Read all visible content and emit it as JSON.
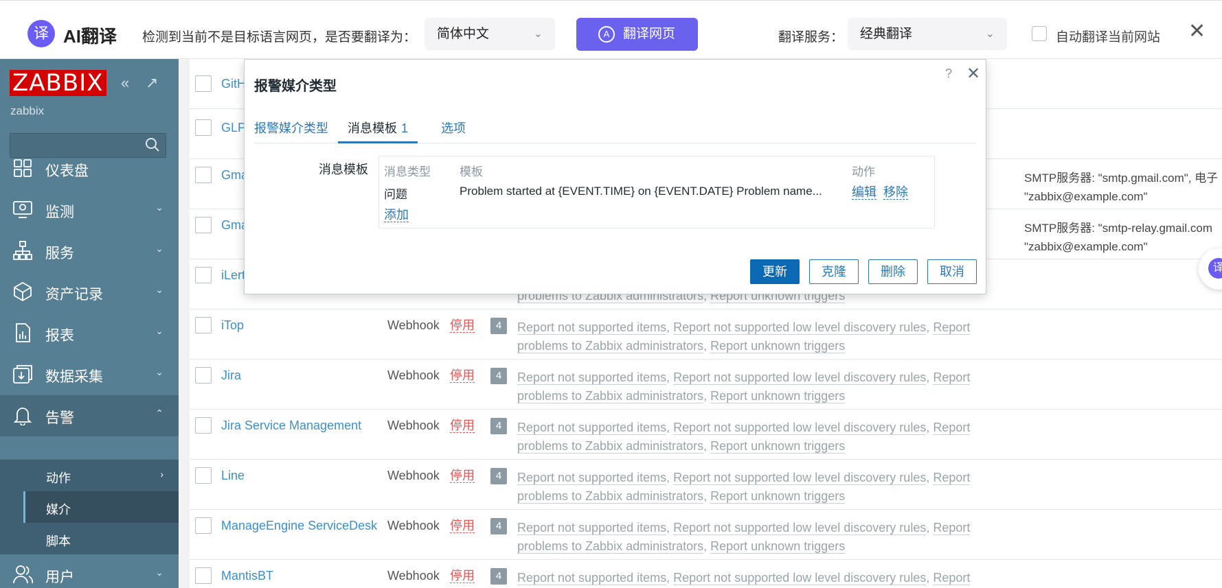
{
  "translate_bar": {
    "logo_char": "译",
    "brand": "AI翻译",
    "prompt": "检测到当前不是目标语言网页，是否要翻译为：",
    "target_language": "简体中文",
    "translate_button": "翻译网页",
    "service_label": "翻译服务：",
    "service_value": "经典翻译",
    "auto_label": "自动翻译当前网站",
    "accent": "#6b61ef"
  },
  "sidebar": {
    "logo": "ZABBIX",
    "server_name": "zabbix",
    "search_placeholder": "",
    "items": [
      {
        "label": "仪表盘"
      },
      {
        "label": "监测"
      },
      {
        "label": "服务"
      },
      {
        "label": "资产记录"
      },
      {
        "label": "报表"
      },
      {
        "label": "数据采集"
      },
      {
        "label": "告警"
      },
      {
        "label": "用户"
      }
    ],
    "sub_items": [
      {
        "label": "动作"
      },
      {
        "label": "媒介"
      },
      {
        "label": "脚本"
      }
    ]
  },
  "table": {
    "rows": [
      {
        "name": "GitHub",
        "type": "",
        "status": "",
        "count": "",
        "actions": [],
        "params": ""
      },
      {
        "name": "GLPi",
        "type": "",
        "status": "",
        "count": "",
        "actions": [],
        "params": ""
      },
      {
        "name": "Gmail",
        "type": "",
        "status": "",
        "count": "",
        "actions": [],
        "params": "SMTP服务器: \"smtp.gmail.com\", 电子",
        "params2": "\"zabbix@example.com\""
      },
      {
        "name": "Gmail relay",
        "type": "",
        "status": "",
        "count": "",
        "actions": [],
        "params": "SMTP服务器: \"smtp-relay.gmail.com",
        "params2": "\"zabbix@example.com\""
      },
      {
        "name": "iLert",
        "type": "",
        "status": "",
        "count": "",
        "actions": [
          "problems to Zabbix administrators",
          "Report unknown triggers"
        ],
        "params": ""
      },
      {
        "name": "iTop",
        "type": "Webhook",
        "status": "停用",
        "count": "4",
        "actions": [
          "Report not supported items",
          "Report not supported low level discovery rules",
          "Report problems to Zabbix administrators",
          "Report unknown triggers"
        ],
        "params": ""
      },
      {
        "name": "Jira",
        "type": "Webhook",
        "status": "停用",
        "count": "4",
        "actions": [
          "Report not supported items",
          "Report not supported low level discovery rules",
          "Report problems to Zabbix administrators",
          "Report unknown triggers"
        ],
        "params": ""
      },
      {
        "name": "Jira Service Management",
        "type": "Webhook",
        "status": "停用",
        "count": "4",
        "actions": [
          "Report not supported items",
          "Report not supported low level discovery rules",
          "Report problems to Zabbix administrators",
          "Report unknown triggers"
        ],
        "params": ""
      },
      {
        "name": "Line",
        "type": "Webhook",
        "status": "停用",
        "count": "4",
        "actions": [
          "Report not supported items",
          "Report not supported low level discovery rules",
          "Report problems to Zabbix administrators",
          "Report unknown triggers"
        ],
        "params": ""
      },
      {
        "name": "ManageEngine ServiceDesk",
        "type": "Webhook",
        "status": "停用",
        "count": "4",
        "actions": [
          "Report not supported items",
          "Report not supported low level discovery rules",
          "Report problems to Zabbix administrators",
          "Report unknown triggers"
        ],
        "params": ""
      },
      {
        "name": "MantisBT",
        "type": "Webhook",
        "status": "停用",
        "count": "4",
        "actions": [
          "Report not supported items",
          "Report not supported low level discovery rules",
          "Report"
        ],
        "params": ""
      }
    ]
  },
  "modal": {
    "title": "报警媒介类型",
    "help": "?",
    "tabs": [
      {
        "label": "报警媒介类型",
        "count": ""
      },
      {
        "label": "消息模板",
        "count": "1"
      },
      {
        "label": "选项",
        "count": ""
      }
    ],
    "field_label": "消息模板",
    "headers": {
      "type": "消息类型",
      "template": "模板",
      "action": "动作"
    },
    "row": {
      "type": "问题",
      "template": "Problem started at {EVENT.TIME} on {EVENT.DATE} Problem name...",
      "edit": "编辑",
      "remove": "移除"
    },
    "add": "添加",
    "buttons": {
      "update": "更新",
      "clone": "克隆",
      "delete": "删除",
      "cancel": "取消"
    }
  }
}
